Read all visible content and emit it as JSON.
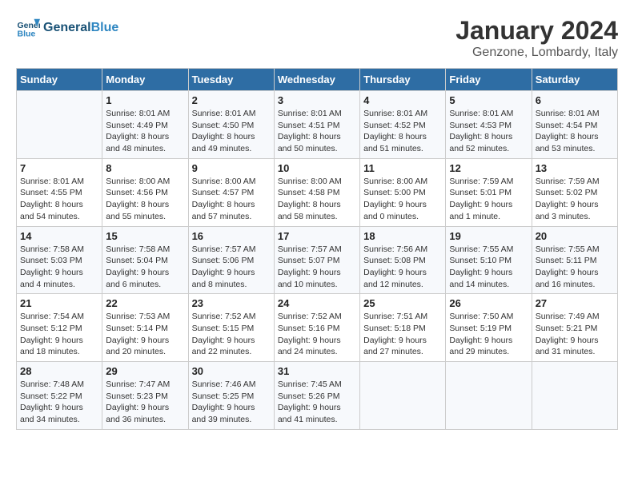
{
  "header": {
    "logo_text_general": "General",
    "logo_text_blue": "Blue",
    "month": "January 2024",
    "location": "Genzone, Lombardy, Italy"
  },
  "weekdays": [
    "Sunday",
    "Monday",
    "Tuesday",
    "Wednesday",
    "Thursday",
    "Friday",
    "Saturday"
  ],
  "weeks": [
    [
      {
        "day": "",
        "sunrise": "",
        "sunset": "",
        "daylight": ""
      },
      {
        "day": "1",
        "sunrise": "Sunrise: 8:01 AM",
        "sunset": "Sunset: 4:49 PM",
        "daylight": "Daylight: 8 hours and 48 minutes."
      },
      {
        "day": "2",
        "sunrise": "Sunrise: 8:01 AM",
        "sunset": "Sunset: 4:50 PM",
        "daylight": "Daylight: 8 hours and 49 minutes."
      },
      {
        "day": "3",
        "sunrise": "Sunrise: 8:01 AM",
        "sunset": "Sunset: 4:51 PM",
        "daylight": "Daylight: 8 hours and 50 minutes."
      },
      {
        "day": "4",
        "sunrise": "Sunrise: 8:01 AM",
        "sunset": "Sunset: 4:52 PM",
        "daylight": "Daylight: 8 hours and 51 minutes."
      },
      {
        "day": "5",
        "sunrise": "Sunrise: 8:01 AM",
        "sunset": "Sunset: 4:53 PM",
        "daylight": "Daylight: 8 hours and 52 minutes."
      },
      {
        "day": "6",
        "sunrise": "Sunrise: 8:01 AM",
        "sunset": "Sunset: 4:54 PM",
        "daylight": "Daylight: 8 hours and 53 minutes."
      }
    ],
    [
      {
        "day": "7",
        "sunrise": "Sunrise: 8:01 AM",
        "sunset": "Sunset: 4:55 PM",
        "daylight": "Daylight: 8 hours and 54 minutes."
      },
      {
        "day": "8",
        "sunrise": "Sunrise: 8:00 AM",
        "sunset": "Sunset: 4:56 PM",
        "daylight": "Daylight: 8 hours and 55 minutes."
      },
      {
        "day": "9",
        "sunrise": "Sunrise: 8:00 AM",
        "sunset": "Sunset: 4:57 PM",
        "daylight": "Daylight: 8 hours and 57 minutes."
      },
      {
        "day": "10",
        "sunrise": "Sunrise: 8:00 AM",
        "sunset": "Sunset: 4:58 PM",
        "daylight": "Daylight: 8 hours and 58 minutes."
      },
      {
        "day": "11",
        "sunrise": "Sunrise: 8:00 AM",
        "sunset": "Sunset: 5:00 PM",
        "daylight": "Daylight: 9 hours and 0 minutes."
      },
      {
        "day": "12",
        "sunrise": "Sunrise: 7:59 AM",
        "sunset": "Sunset: 5:01 PM",
        "daylight": "Daylight: 9 hours and 1 minute."
      },
      {
        "day": "13",
        "sunrise": "Sunrise: 7:59 AM",
        "sunset": "Sunset: 5:02 PM",
        "daylight": "Daylight: 9 hours and 3 minutes."
      }
    ],
    [
      {
        "day": "14",
        "sunrise": "Sunrise: 7:58 AM",
        "sunset": "Sunset: 5:03 PM",
        "daylight": "Daylight: 9 hours and 4 minutes."
      },
      {
        "day": "15",
        "sunrise": "Sunrise: 7:58 AM",
        "sunset": "Sunset: 5:04 PM",
        "daylight": "Daylight: 9 hours and 6 minutes."
      },
      {
        "day": "16",
        "sunrise": "Sunrise: 7:57 AM",
        "sunset": "Sunset: 5:06 PM",
        "daylight": "Daylight: 9 hours and 8 minutes."
      },
      {
        "day": "17",
        "sunrise": "Sunrise: 7:57 AM",
        "sunset": "Sunset: 5:07 PM",
        "daylight": "Daylight: 9 hours and 10 minutes."
      },
      {
        "day": "18",
        "sunrise": "Sunrise: 7:56 AM",
        "sunset": "Sunset: 5:08 PM",
        "daylight": "Daylight: 9 hours and 12 minutes."
      },
      {
        "day": "19",
        "sunrise": "Sunrise: 7:55 AM",
        "sunset": "Sunset: 5:10 PM",
        "daylight": "Daylight: 9 hours and 14 minutes."
      },
      {
        "day": "20",
        "sunrise": "Sunrise: 7:55 AM",
        "sunset": "Sunset: 5:11 PM",
        "daylight": "Daylight: 9 hours and 16 minutes."
      }
    ],
    [
      {
        "day": "21",
        "sunrise": "Sunrise: 7:54 AM",
        "sunset": "Sunset: 5:12 PM",
        "daylight": "Daylight: 9 hours and 18 minutes."
      },
      {
        "day": "22",
        "sunrise": "Sunrise: 7:53 AM",
        "sunset": "Sunset: 5:14 PM",
        "daylight": "Daylight: 9 hours and 20 minutes."
      },
      {
        "day": "23",
        "sunrise": "Sunrise: 7:52 AM",
        "sunset": "Sunset: 5:15 PM",
        "daylight": "Daylight: 9 hours and 22 minutes."
      },
      {
        "day": "24",
        "sunrise": "Sunrise: 7:52 AM",
        "sunset": "Sunset: 5:16 PM",
        "daylight": "Daylight: 9 hours and 24 minutes."
      },
      {
        "day": "25",
        "sunrise": "Sunrise: 7:51 AM",
        "sunset": "Sunset: 5:18 PM",
        "daylight": "Daylight: 9 hours and 27 minutes."
      },
      {
        "day": "26",
        "sunrise": "Sunrise: 7:50 AM",
        "sunset": "Sunset: 5:19 PM",
        "daylight": "Daylight: 9 hours and 29 minutes."
      },
      {
        "day": "27",
        "sunrise": "Sunrise: 7:49 AM",
        "sunset": "Sunset: 5:21 PM",
        "daylight": "Daylight: 9 hours and 31 minutes."
      }
    ],
    [
      {
        "day": "28",
        "sunrise": "Sunrise: 7:48 AM",
        "sunset": "Sunset: 5:22 PM",
        "daylight": "Daylight: 9 hours and 34 minutes."
      },
      {
        "day": "29",
        "sunrise": "Sunrise: 7:47 AM",
        "sunset": "Sunset: 5:23 PM",
        "daylight": "Daylight: 9 hours and 36 minutes."
      },
      {
        "day": "30",
        "sunrise": "Sunrise: 7:46 AM",
        "sunset": "Sunset: 5:25 PM",
        "daylight": "Daylight: 9 hours and 39 minutes."
      },
      {
        "day": "31",
        "sunrise": "Sunrise: 7:45 AM",
        "sunset": "Sunset: 5:26 PM",
        "daylight": "Daylight: 9 hours and 41 minutes."
      },
      {
        "day": "",
        "sunrise": "",
        "sunset": "",
        "daylight": ""
      },
      {
        "day": "",
        "sunrise": "",
        "sunset": "",
        "daylight": ""
      },
      {
        "day": "",
        "sunrise": "",
        "sunset": "",
        "daylight": ""
      }
    ]
  ]
}
